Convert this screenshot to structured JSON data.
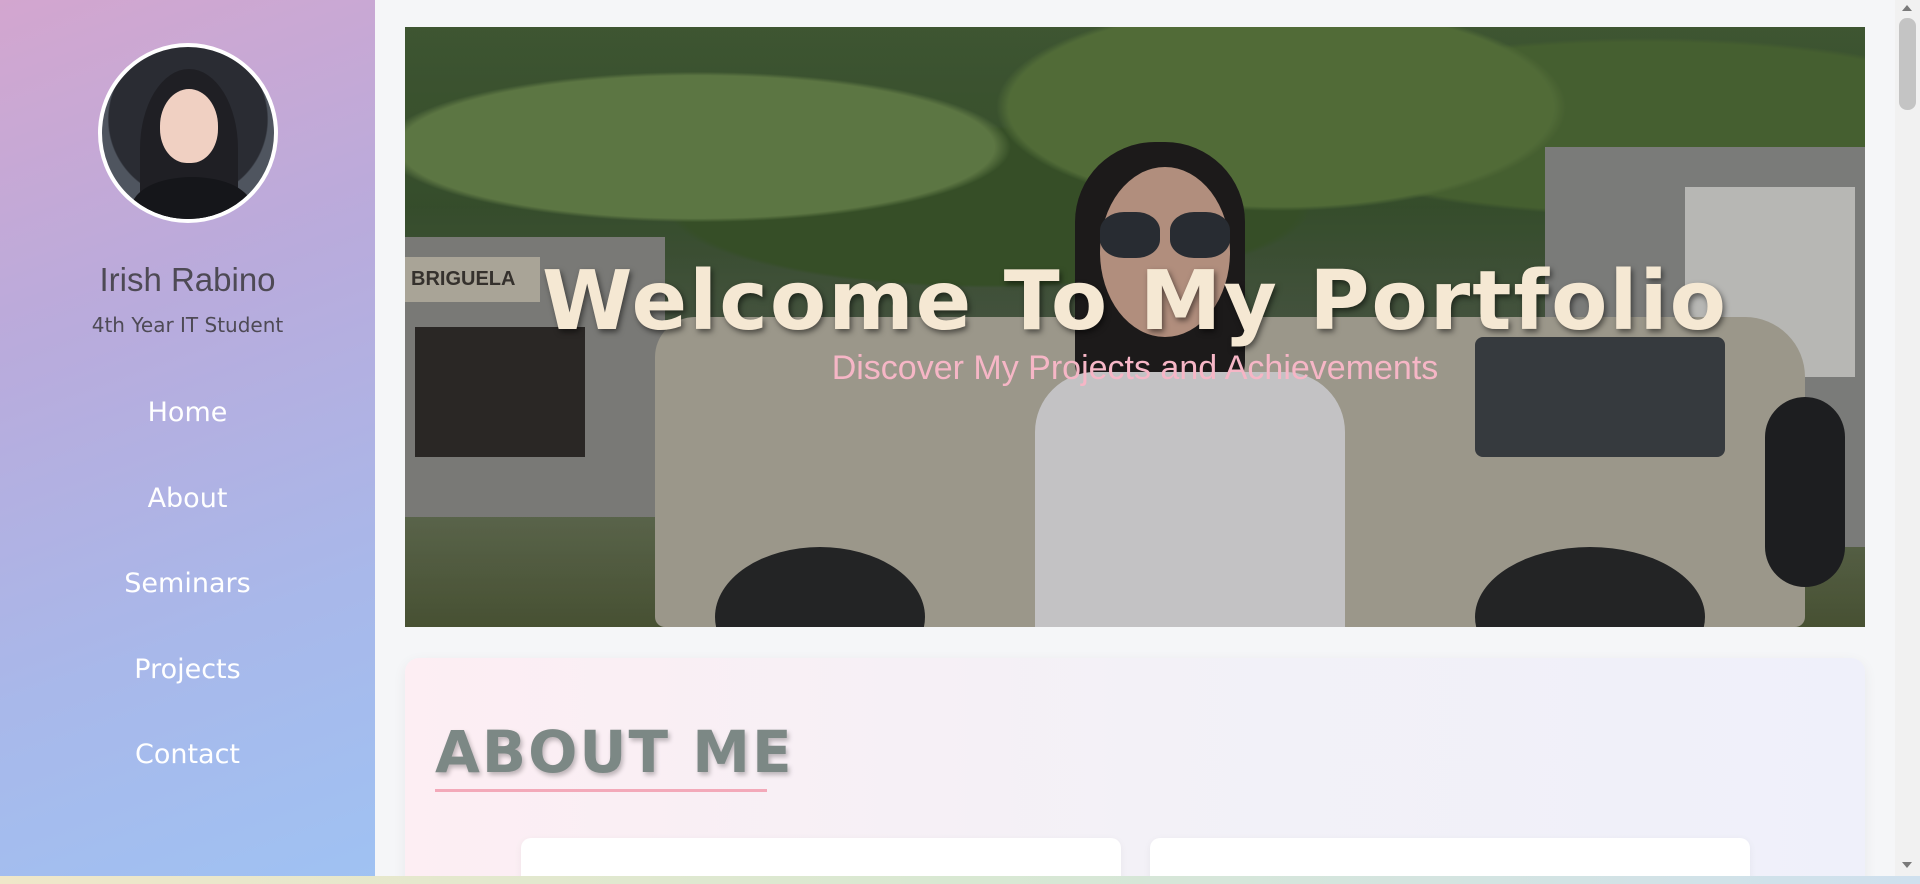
{
  "profile": {
    "name": "Irish Rabino",
    "role": "4th Year IT Student"
  },
  "nav": {
    "items": [
      {
        "label": "Home"
      },
      {
        "label": "About"
      },
      {
        "label": "Seminars"
      },
      {
        "label": "Projects"
      },
      {
        "label": "Contact"
      }
    ]
  },
  "hero": {
    "title": "Welcome To My Portfolio",
    "subtitle": "Discover My Projects and Achievements",
    "sign_text": "BRIGUELA"
  },
  "about": {
    "title": "ABOUT ME"
  },
  "colors": {
    "sidebar_gradient_start": "#d3a6cf",
    "sidebar_gradient_end": "#9fc2f3",
    "hero_title": "#f5e8d3",
    "hero_subtitle": "#f6b6c6",
    "about_title": "#7c8885",
    "about_underline": "#f3a9b9"
  }
}
